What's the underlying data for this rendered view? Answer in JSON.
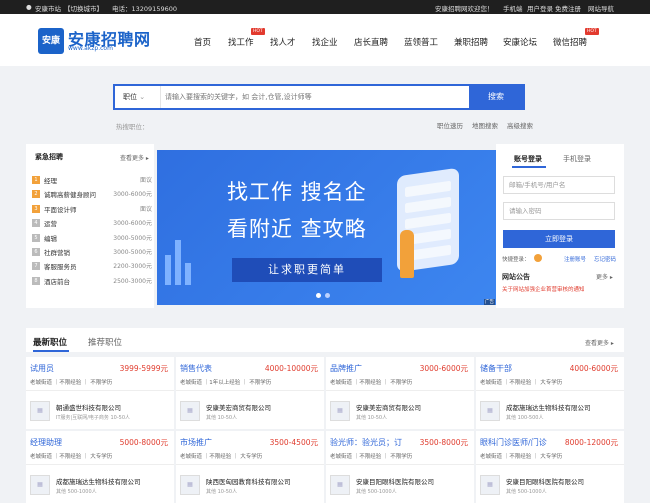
{
  "topbar": {
    "city": "安康市站",
    "switch_city": "【切换城市】",
    "phone": "电话：13209159600",
    "welcome": "安康招聘网欢迎您！",
    "mobile": "手机端",
    "user_login": "用户登录",
    "register": "免费注册",
    "site_nav": "网站导航"
  },
  "logo": {
    "badge": "安康",
    "name": "安康招聘网",
    "url": "www.akzp.com"
  },
  "nav": {
    "items": [
      "首页",
      "找工作",
      "找人才",
      "找企业",
      "店长直聘",
      "蓝领普工",
      "兼职招聘",
      "安康论坛",
      "微信招聘"
    ],
    "badge": "HOT"
  },
  "search": {
    "type": "职位",
    "placeholder": "请输入要搜索的关键字，如 会计,仓管,设计师等",
    "button": "搜索",
    "hot_label": "热搜职位：",
    "links": [
      "职位速历",
      "地图搜索",
      "高级搜索"
    ]
  },
  "urgent": {
    "title": "紧急招聘",
    "more": "查看更多 ▸",
    "items": [
      {
        "n": "1",
        "title": "经理",
        "salary": "面议"
      },
      {
        "n": "2",
        "title": "诚聘高薪健身顾问",
        "salary": "3000-6000元"
      },
      {
        "n": "3",
        "title": "平面设计师",
        "salary": "面议"
      },
      {
        "n": "4",
        "title": "运营",
        "salary": "3000-6000元"
      },
      {
        "n": "5",
        "title": "编辑",
        "salary": "3000-5000元"
      },
      {
        "n": "6",
        "title": "社群营销",
        "salary": "3000-5000元"
      },
      {
        "n": "7",
        "title": "客服服务员",
        "salary": "2200-3000元"
      },
      {
        "n": "8",
        "title": "酒店前台",
        "salary": "2500-3000元"
      }
    ]
  },
  "banner": {
    "line1": "找工作  搜名企",
    "line2": "看附近  查攻略",
    "slogan": "让求职更简单",
    "ad": "广告"
  },
  "login": {
    "tab_account": "账号登录",
    "tab_mobile": "手机登录",
    "user_placeholder": "邮箱/手机号/用户名",
    "pass_placeholder": "请输入密码",
    "button": "立即登录",
    "quick": "快捷登录：",
    "register": "注册账号",
    "forgot": "忘记密码",
    "notice_title": "网站公告",
    "notice_more": "更多 ▸",
    "notice_text": "关于网站加强企业首营审核的通知"
  },
  "jobs": {
    "tab_latest": "最新职位",
    "tab_recommend": "推荐职位",
    "more": "查看更多 ▸",
    "list": [
      {
        "title": "试用员",
        "salary": "3999-5999元",
        "req": "老城街道 ｜不限经验 ｜ 不限学历",
        "company": "朝通盛世科技有限公司",
        "info": "IT服务|互联网/电子商务  10-50人"
      },
      {
        "title": "销售代表",
        "salary": "4000-10000元",
        "req": "老城街道 ｜1年以上经验 ｜ 不限学历",
        "company": "安康美宏商贸有限公司",
        "info": "其他  10-50人"
      },
      {
        "title": "品牌推广",
        "salary": "3000-6000元",
        "req": "老城街道 ｜不限经验 ｜ 不限学历",
        "company": "安康美宏商贸有限公司",
        "info": "其他  10-50人"
      },
      {
        "title": "储备干部",
        "salary": "4000-6000元",
        "req": "老城街道 ｜不限经验 ｜ 大专学历",
        "company": "成都施瑞达生物科技有限公司",
        "info": "其他  100-500人"
      },
      {
        "title": "经理助理",
        "salary": "5000-8000元",
        "req": "老城街道 ｜不限经验 ｜ 大专学历",
        "company": "成都施瑞达生物科技有限公司",
        "info": "其他  500-1000人"
      },
      {
        "title": "市场推广",
        "salary": "3500-4500元",
        "req": "老城街道 ｜不限经验 ｜ 大专学历",
        "company": "陕西医匈园教育科技有限公司",
        "info": "其他  10-50人"
      },
      {
        "title": "验光师：验光员；订",
        "salary": "3500-8000元",
        "req": "老城街道 ｜不限经验 ｜ 不限学历",
        "company": "安康目阳眼科医院有限公司",
        "info": "其他  500-1000人"
      },
      {
        "title": "眼科门诊医师/门诊",
        "salary": "8000-12000元",
        "req": "老城街道 ｜不限经验 ｜ 大专学历",
        "company": "安康目阳眼科医院有限公司",
        "info": "其他  500-1000人"
      }
    ]
  }
}
